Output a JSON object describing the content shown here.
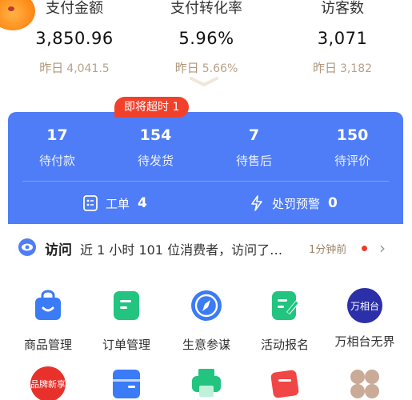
{
  "stats": [
    {
      "label": "支付金额",
      "value": "3,850.96",
      "prev_label": "昨日",
      "prev_value": "4,041.5"
    },
    {
      "label": "支付转化率",
      "value": "5.96%",
      "prev_label": "昨日",
      "prev_value": "5.66%"
    },
    {
      "label": "访客数",
      "value": "3,071",
      "prev_label": "昨日",
      "prev_value": "3,182"
    }
  ],
  "orders": [
    {
      "count": "17",
      "label": "待付款"
    },
    {
      "count": "154",
      "label": "待发货"
    },
    {
      "count": "7",
      "label": "待售后"
    },
    {
      "count": "150",
      "label": "待评价"
    }
  ],
  "timeout_badge": "即将超时 1",
  "tickets": {
    "label": "工单",
    "count": "4"
  },
  "penalty": {
    "label": "处罚预警",
    "count": "0"
  },
  "visit": {
    "title": "访问",
    "message": "近 1 小时 101 位消费者，访问了…",
    "time": "1分钟前"
  },
  "apps_row1": [
    {
      "label": "商品管理",
      "icon": "bag-icon"
    },
    {
      "label": "订单管理",
      "icon": "order-icon"
    },
    {
      "label": "生意参谋",
      "icon": "compass-icon"
    },
    {
      "label": "活动报名",
      "icon": "edit-icon"
    },
    {
      "label": "万相台无界",
      "icon": "wanxiangtai-icon",
      "icon_text": "万相台"
    }
  ],
  "apps_row2": [
    {
      "label": "",
      "icon": "brand-new-icon",
      "icon_text": "品牌新享"
    },
    {
      "label": "",
      "icon": "box-icon"
    },
    {
      "label": "",
      "icon": "printer-icon"
    },
    {
      "label": "",
      "icon": "ticket-icon"
    },
    {
      "label": "",
      "icon": "more-icon"
    }
  ],
  "colors": {
    "accent_blue": "#4f7df7",
    "badge_red": "#f2412b",
    "green": "#22c47f",
    "muted_gold": "#b0967a"
  }
}
